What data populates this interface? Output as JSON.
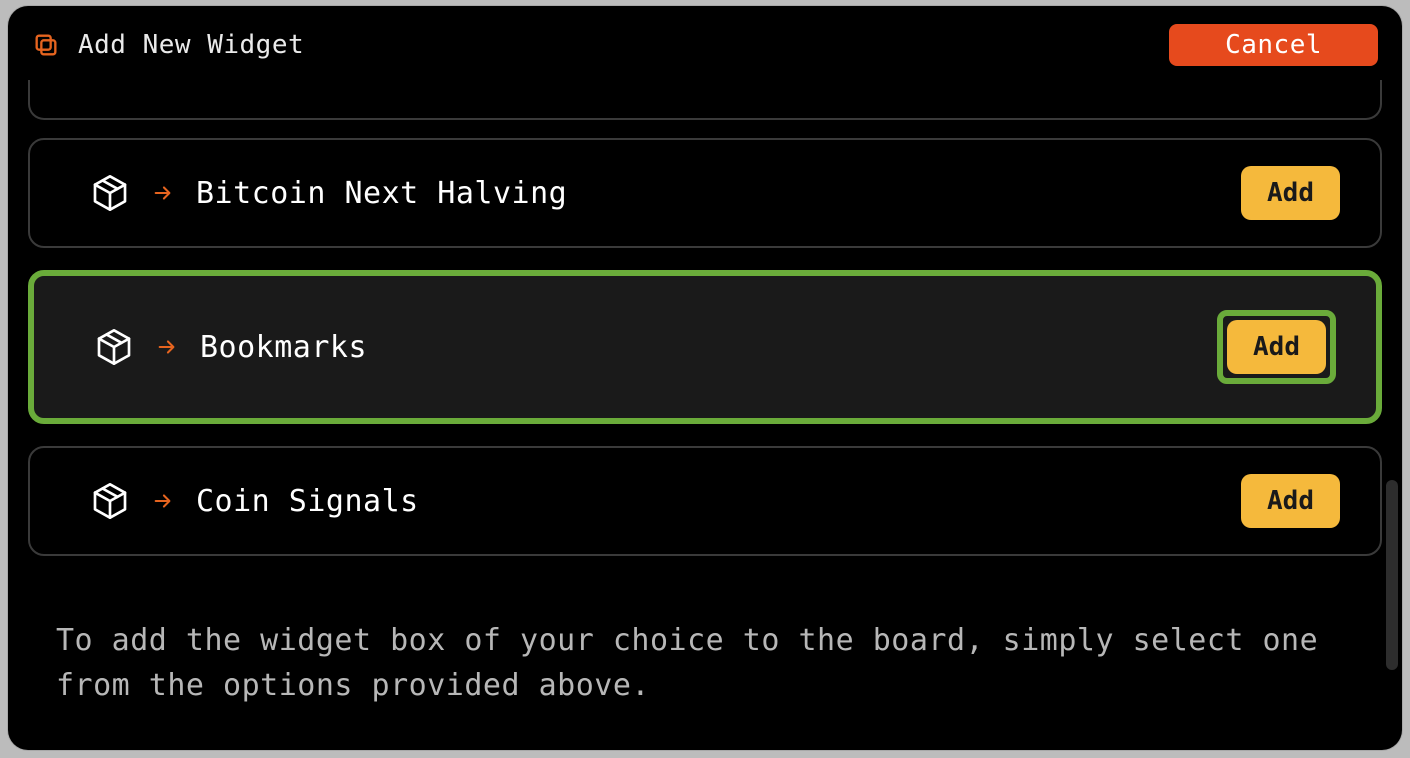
{
  "header": {
    "title": "Add New Widget",
    "cancel_label": "Cancel"
  },
  "widgets": [
    {
      "label": "Bitcoin Next Halving",
      "add_label": "Add",
      "highlighted": false
    },
    {
      "label": "Bookmarks",
      "add_label": "Add",
      "highlighted": true
    },
    {
      "label": "Coin Signals",
      "add_label": "Add",
      "highlighted": false
    }
  ],
  "footer": {
    "text": "To add the widget box of your choice to the board, simply select one from the options provided above."
  }
}
